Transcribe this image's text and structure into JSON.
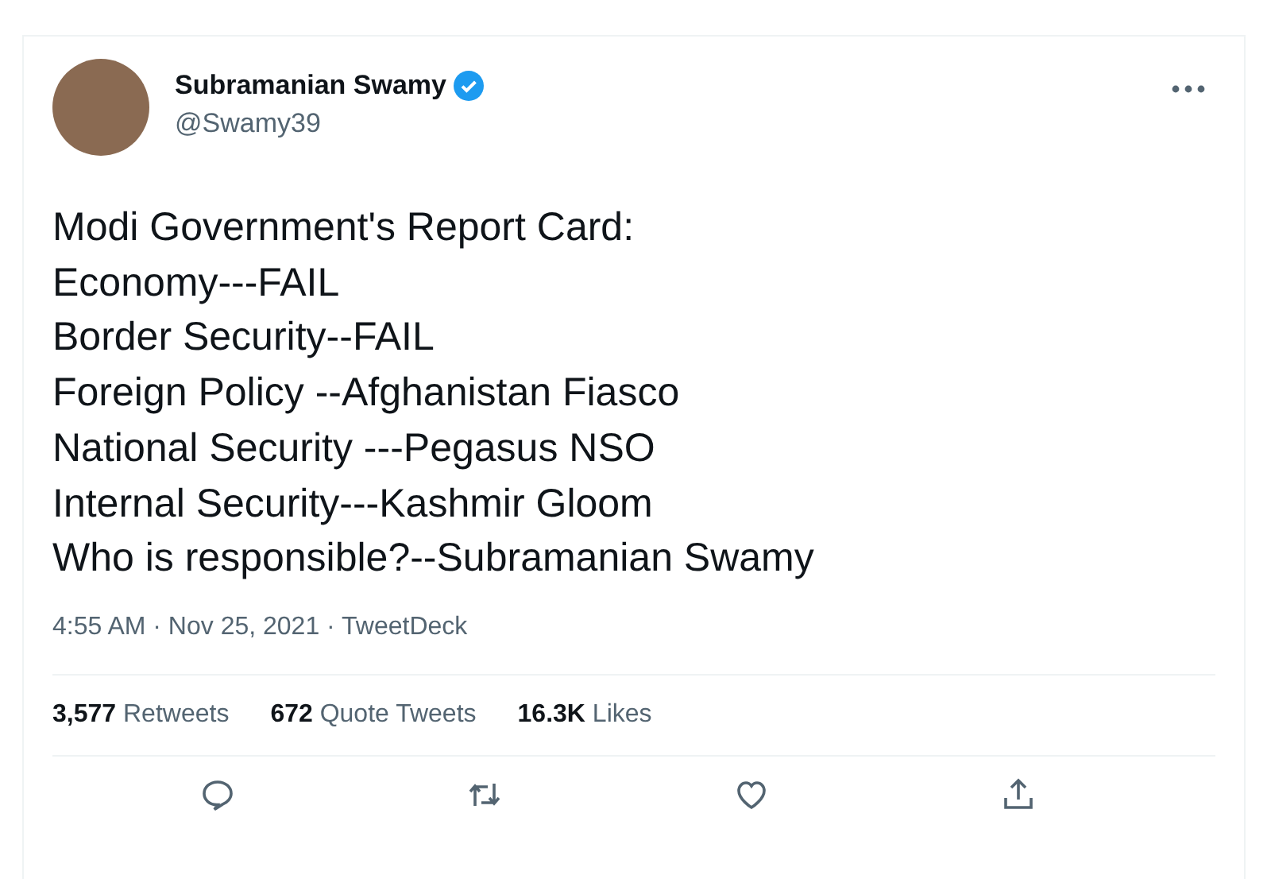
{
  "author": {
    "name": "Subramanian Swamy",
    "handle": "@Swamy39",
    "verified": true
  },
  "tweet_text": "Modi Government's Report Card:\nEconomy---FAIL\nBorder Security--FAIL\nForeign Policy --Afghanistan Fiasco\nNational Security ---Pegasus NSO\nInternal Security---Kashmir Gloom\nWho is responsible?--Subramanian Swamy",
  "timestamp": "4:55 AM · Nov 25, 2021 · TweetDeck",
  "stats": [
    {
      "text": "**3,577** Retweets"
    },
    {
      "text": "**672** Quote Tweets"
    },
    {
      "text": "**16.3K** Likes"
    }
  ],
  "actions": [
    {
      "kind": "reply"
    },
    {
      "kind": "retweet"
    },
    {
      "kind": "like"
    },
    {
      "kind": "share"
    }
  ]
}
